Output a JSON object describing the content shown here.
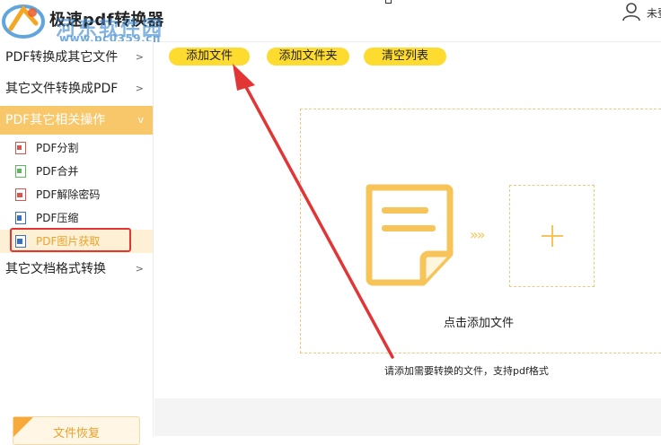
{
  "window": {
    "title": "极速pdf转换器",
    "user_label": "未登"
  },
  "watermark": {
    "site_name": "河东软件园",
    "url": "www.pc0359.cn"
  },
  "sidebar": {
    "categories": [
      {
        "label": "PDF转换成其它文件",
        "chevron": ">"
      },
      {
        "label": "其它文件转换成PDF",
        "chevron": ">"
      },
      {
        "label": "PDF其它相关操作",
        "chevron": "v",
        "expanded": true
      },
      {
        "label": "其它文档格式转换",
        "chevron": ">"
      }
    ],
    "sub_items": [
      {
        "label": "PDF分割",
        "icon": "pdf-split-icon"
      },
      {
        "label": "PDF合并",
        "icon": "pdf-merge-icon"
      },
      {
        "label": "PDF解除密码",
        "icon": "pdf-unlock-icon"
      },
      {
        "label": "PDF压缩",
        "icon": "pdf-compress-icon"
      },
      {
        "label": "PDF图片获取",
        "icon": "pdf-image-extract-icon",
        "selected": true
      }
    ],
    "recover_label": "文件恢复"
  },
  "toolbar": {
    "add_file": "添加文件",
    "add_folder": "添加文件夹",
    "clear_list": "清空列表"
  },
  "main": {
    "drop_label": "点击添加文件",
    "hint": "请添加需要转换的文件，支持pdf格式",
    "arrows": "»»"
  },
  "colors": {
    "accent_yellow": "#fddc2f",
    "active_category": "#f7c76a",
    "selected_text": "#e9a32a",
    "annotation_red": "#e23636",
    "dashed_border": "#f5c77a"
  }
}
